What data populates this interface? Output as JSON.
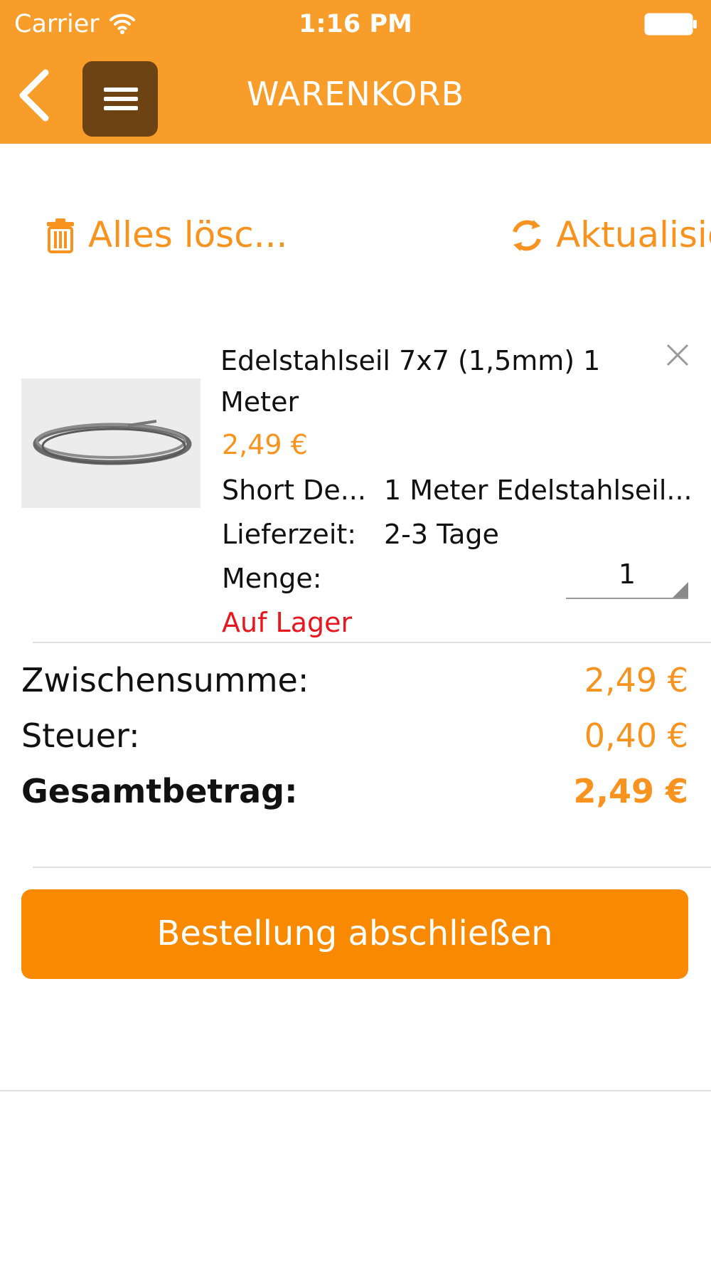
{
  "status_bar": {
    "carrier": "Carrier",
    "time": "1:16 PM"
  },
  "header": {
    "title": "WARENKORB",
    "background_color": "#f99d2a",
    "menu_button_color": "#6d4313"
  },
  "actions": {
    "clear_all_label": "Alles lösc...",
    "refresh_label": "Aktualisie",
    "accent_color": "#f7931e"
  },
  "cart_item": {
    "title": "Edelstahlseil 7x7 (1,5mm) 1 Meter",
    "price": "2,49 €",
    "short_description_label": "Short De...",
    "short_description_value": "1 Meter Edelstahlseil...",
    "delivery_label": "Lieferzeit:",
    "delivery_value": "2-3 Tage",
    "quantity_label": "Menge:",
    "quantity_value": "1",
    "stock_status": "Auf Lager",
    "stock_status_color": "#e8171f"
  },
  "totals": {
    "subtotal_label": "Zwischensumme:",
    "subtotal_value": "2,49 €",
    "tax_label": "Steuer:",
    "tax_value": "0,40 €",
    "grand_total_label": "Gesamtbetrag:",
    "grand_total_value": "2,49 €"
  },
  "checkout": {
    "button_label": "Bestellung abschließen",
    "button_color": "#f98a00"
  }
}
